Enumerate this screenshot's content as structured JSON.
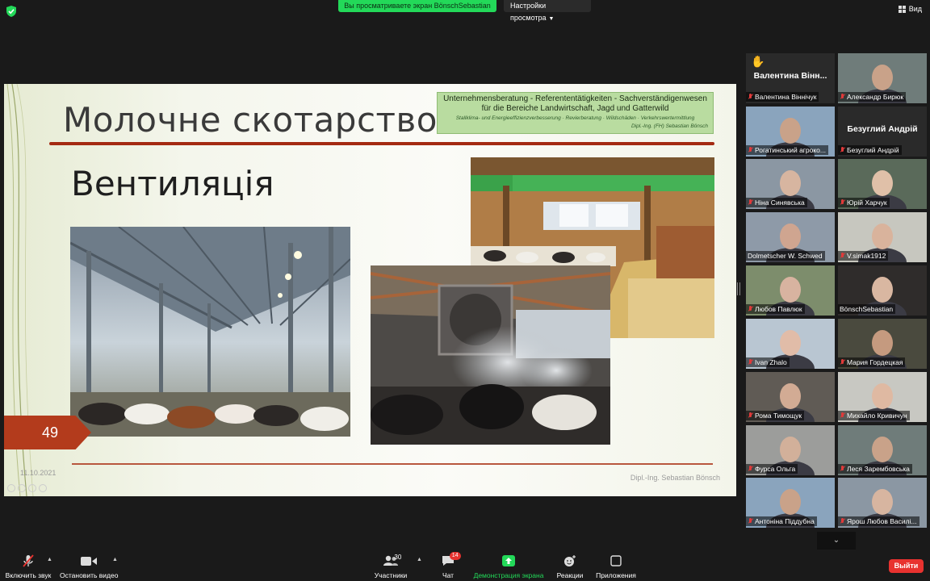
{
  "banner": {
    "text": "Вы просматриваете экран BönschSebastian"
  },
  "view_options": {
    "label": "Настройки просмотра"
  },
  "view_button": {
    "label": "Вид"
  },
  "slide": {
    "title": "Молочне скотарство",
    "subtitle": "Вентиляція",
    "logo_line1": "Unternehmensberatung  -  Referententätigkeiten  -  Sachverständigenwesen",
    "logo_line2": "für die Bereiche Landwirtschaft, Jagd und Gatterwild",
    "logo_line3": "Stallklima- und Energieeffizienzverbesserung · Revierberatung · Wildschäden · Verkehrswertermittlung",
    "logo_line4": "Dipl.-Ing. (FH) Sebastian Bönsch",
    "page_number": "49",
    "date": "11.10.2021",
    "author": "Dipl.-Ing. Sebastian Bönsch"
  },
  "participants": [
    {
      "name": "Валентина Віннічук",
      "display": "Валентина  Вінн...",
      "video": false,
      "hand": true,
      "muted": true
    },
    {
      "name": "Александр Бирюк",
      "video": true,
      "muted": true
    },
    {
      "name": "Рогатинський агроко...",
      "video": true,
      "muted": true
    },
    {
      "name": "Безуглий Андрій",
      "display": "Безуглий Андрій",
      "video": false,
      "muted": true
    },
    {
      "name": "Ніна Синявська",
      "video": true,
      "muted": true
    },
    {
      "name": "Юрій Харчук",
      "video": true,
      "muted": true
    },
    {
      "name": "Dolmetscher W. Schwed",
      "video": true,
      "muted": false,
      "active": true
    },
    {
      "name": "V.simak1912",
      "video": true,
      "muted": true
    },
    {
      "name": "Любов Павлюк",
      "video": true,
      "muted": true
    },
    {
      "name": "BönschSebastian",
      "video": true,
      "muted": false
    },
    {
      "name": "Ivan Zhalo",
      "video": true,
      "muted": true
    },
    {
      "name": "Мария Гордецкая",
      "video": true,
      "muted": true
    },
    {
      "name": "Рома Тимощук",
      "video": true,
      "muted": true
    },
    {
      "name": "Михайло Кривичун",
      "video": true,
      "muted": true
    },
    {
      "name": "Фурса Ольга",
      "video": true,
      "muted": true
    },
    {
      "name": "Леся Зарембовська",
      "video": true,
      "muted": true
    },
    {
      "name": "Антоніна Піддубна",
      "video": true,
      "muted": true
    },
    {
      "name": "Ярош Любов Василі...",
      "video": true,
      "muted": true
    }
  ],
  "toolbar": {
    "audio": "Включить звук",
    "video": "Остановить видео",
    "participants": "Участники",
    "participants_count": "30",
    "chat": "Чат",
    "chat_badge": "14",
    "share": "Демонстрация экрана",
    "reactions": "Реакции",
    "apps": "Приложения",
    "leave": "Выйти"
  },
  "colors": {
    "accent_green": "#23d959",
    "leave_red": "#e8322f",
    "slide_red": "#a42a12",
    "active_outline": "#e6e615"
  }
}
